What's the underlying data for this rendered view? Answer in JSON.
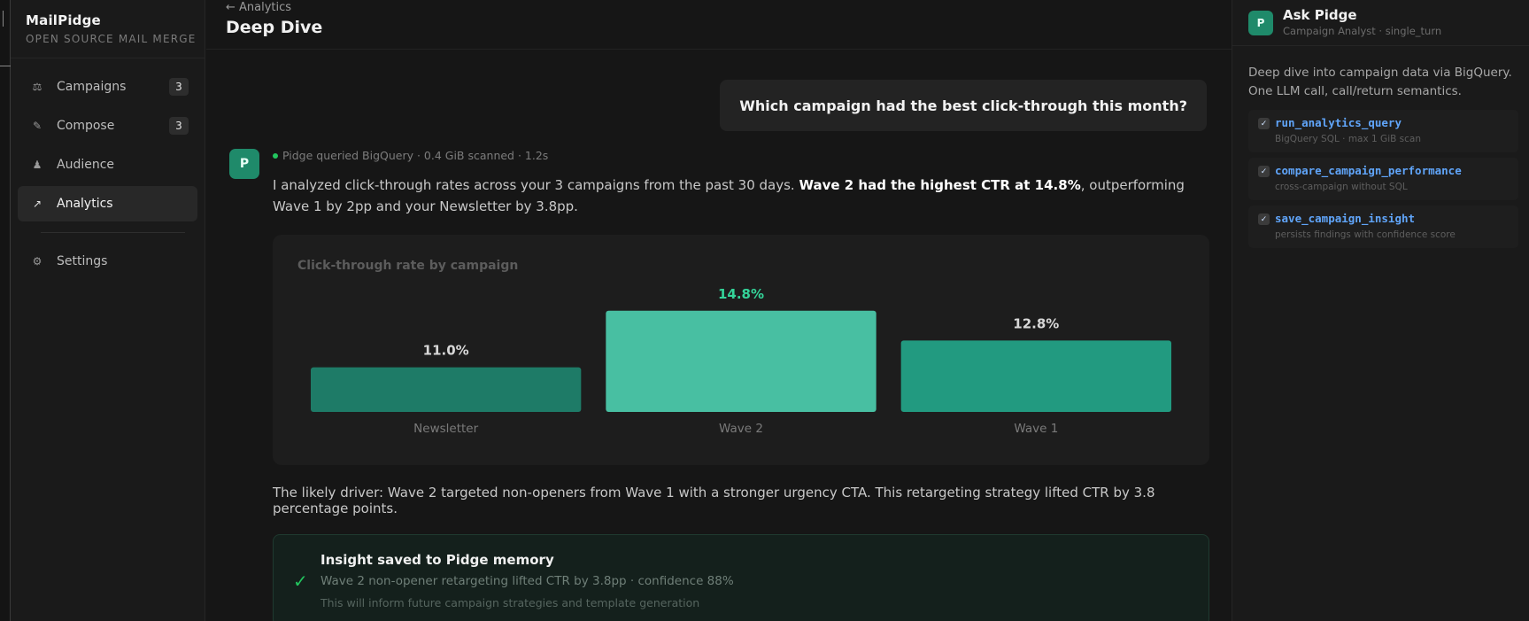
{
  "app": {
    "name": "MailPidge",
    "tagline": "OPEN SOURCE MAIL MERGE"
  },
  "sidebar": {
    "items": [
      {
        "label": "Campaigns",
        "icon": "scale-icon",
        "badge": "3"
      },
      {
        "label": "Compose",
        "icon": "pencil-icon",
        "badge": "3"
      },
      {
        "label": "Audience",
        "icon": "person-icon"
      },
      {
        "label": "Analytics",
        "icon": "trend-arrow-icon",
        "active": true
      }
    ],
    "settings": {
      "label": "Settings",
      "icon": "gear-icon"
    }
  },
  "header": {
    "back_label": "← Analytics",
    "title": "Deep Dive"
  },
  "conversation": {
    "user_message": "Which campaign had the best click-through this month?",
    "assistant": {
      "avatar_letter": "P",
      "meta": "Pidge queried BigQuery · 0.4 GiB scanned · 1.2s",
      "intro_pre": "I analyzed click-through rates across your 3 campaigns from the past 30 days. ",
      "intro_bold": "Wave 2 had the highest CTR at 14.8%",
      "intro_post": ", outperforming Wave 1 by 2pp and your Newsletter by 3.8pp.",
      "driver": "The likely driver: Wave 2 targeted non-openers from Wave 1 with a stronger urgency CTA. This retargeting strategy lifted CTR by 3.8 percentage points."
    },
    "insight": {
      "title": "Insight saved to Pidge memory",
      "detail": "Wave 2 non-opener retargeting lifted CTR by 3.8pp · confidence 88%",
      "note": "This will inform future campaign strategies and template generation"
    }
  },
  "chart_data": {
    "type": "bar",
    "title": "Click-through rate by campaign",
    "categories": [
      "Newsletter",
      "Wave 2",
      "Wave 1"
    ],
    "values": [
      11.0,
      14.8,
      12.8
    ],
    "value_labels": [
      "11.0%",
      "14.8%",
      "12.8%"
    ],
    "colors": [
      "#1e7b67",
      "#48bfa2",
      "#229a80"
    ],
    "highlight_color": "#34d399",
    "highlight_index": 1,
    "ylim": [
      0,
      16
    ]
  },
  "panel": {
    "avatar_letter": "P",
    "title": "Ask Pidge",
    "subtitle": "Campaign Analyst · single_turn",
    "description": "Deep dive into campaign data via BigQuery. One LLM call, call/return semantics.",
    "tools": [
      {
        "name": "run_analytics_query",
        "desc": "BigQuery SQL · max 1 GiB scan"
      },
      {
        "name": "compare_campaign_performance",
        "desc": "cross-campaign without SQL"
      },
      {
        "name": "save_campaign_insight",
        "desc": "persists findings with confidence score"
      }
    ]
  },
  "colors": {
    "accent": "#1f8a6a",
    "success": "#22c55e",
    "tool_link": "#60a5fa"
  }
}
